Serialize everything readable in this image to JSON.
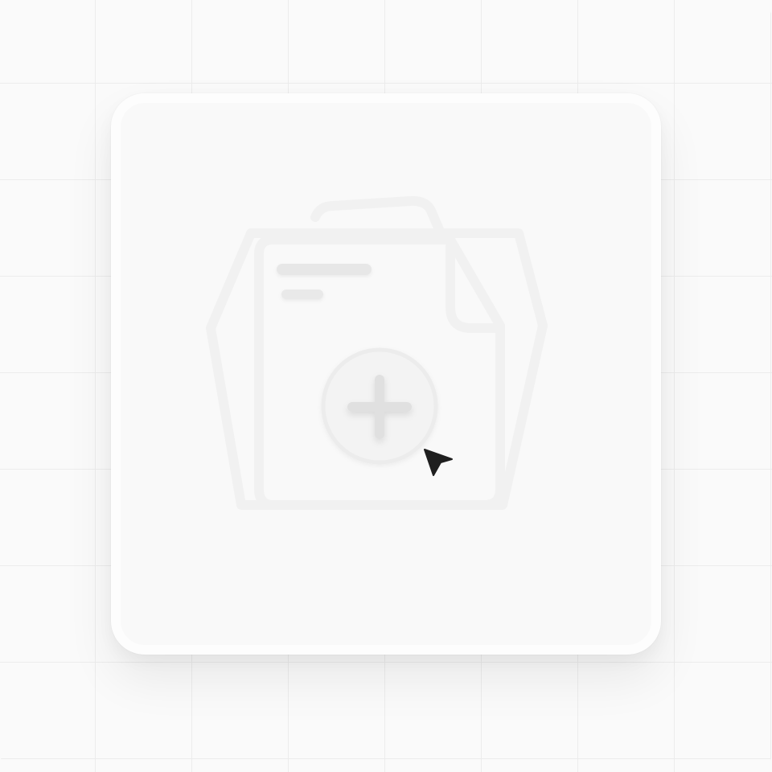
{
  "colors": {
    "background": "#fafafa",
    "grid_line": "#ececec",
    "card_fill": "#f9f9f9",
    "card_border": "#fdfdfd",
    "outline": "#f2f2f2",
    "placeholder_bar": "#e6e6e6",
    "plus_glyph": "#e2e2e2",
    "cursor": "#222222"
  },
  "icons": {
    "document_stack": "document-stack-icon",
    "add": "plus-icon",
    "pointer": "cursor-arrow-icon"
  }
}
